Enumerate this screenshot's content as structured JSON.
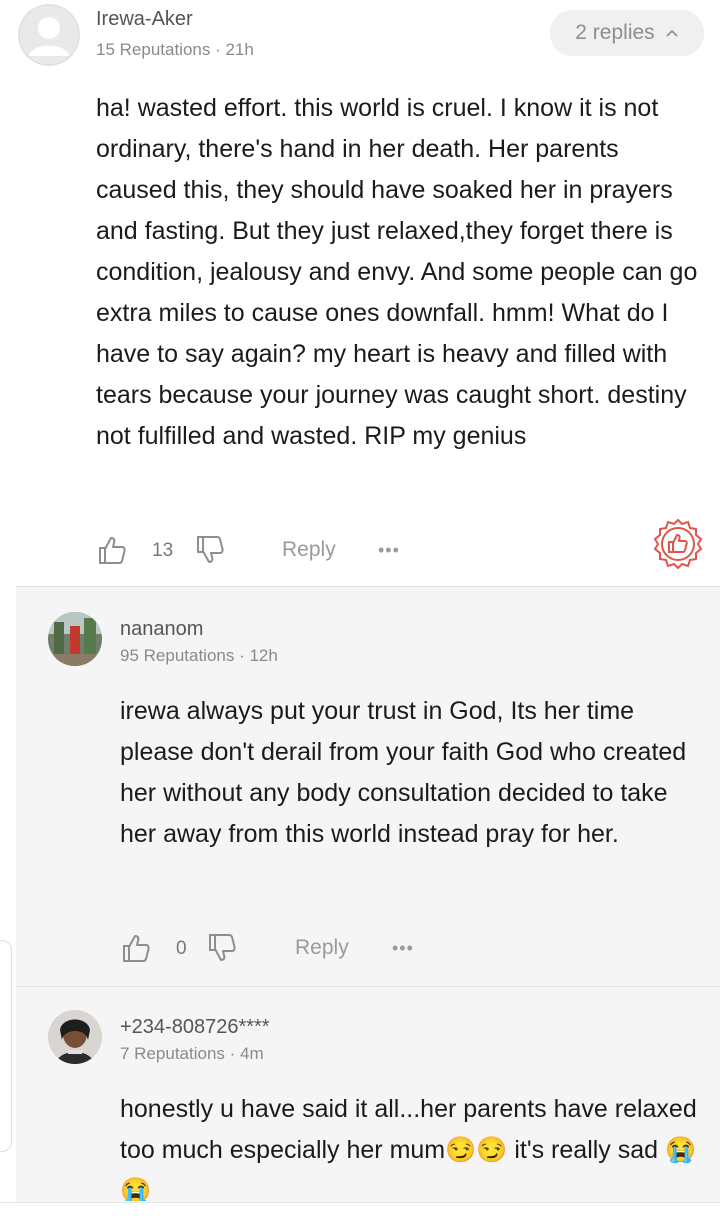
{
  "main_comment": {
    "author": "Irewa-Aker",
    "meta": "15 Reputations · 21h",
    "replies_label": "2 replies",
    "text": "ha!  wasted effort. this world is cruel. I know it is not ordinary, there's  hand in her death.  Her parents caused this, they should have soaked her in prayers and fasting. But they just relaxed,they forget there is condition, jealousy and envy. And some people can go extra miles to cause ones downfall. hmm! What do I have to say again? my heart is heavy and filled with tears because your journey was caught short.  destiny not fulfilled and wasted. RIP my genius",
    "likes": "13",
    "reply_label": "Reply",
    "more_label": "•••"
  },
  "replies": [
    {
      "author": "nananom",
      "meta": "95 Reputations · 12h",
      "text": "irewa always put your trust in God, Its her time please don't derail from your faith God who created her without any body consultation decided to take her away from this world instead pray for her.",
      "likes": "0",
      "reply_label": "Reply",
      "more_label": "•••"
    },
    {
      "author": "+234-808726****",
      "meta": "7 Reputations · 4m",
      "text": "honestly u have said it all...her parents have relaxed too much especially her mum😏😏 it's really sad 😭😭"
    }
  ],
  "icons": {
    "like": "thumbs-up-outline",
    "dislike": "thumbs-down-outline",
    "badge": "thumbs-up-seal",
    "collapse": "chevron-up"
  },
  "colors": {
    "badge_red": "#e0554a",
    "reply_bg": "#f5f5f5",
    "pill_bg": "#f0f0f0"
  }
}
